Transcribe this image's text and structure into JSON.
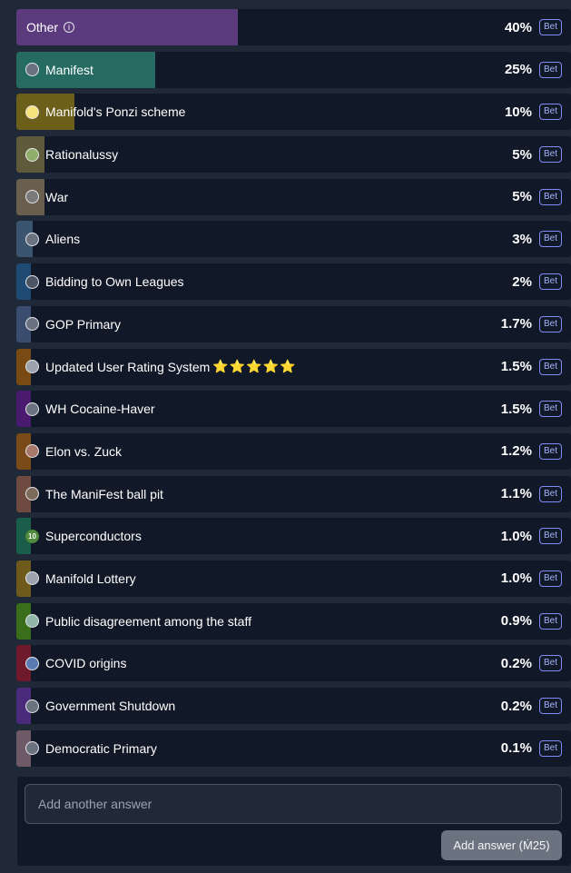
{
  "answers": [
    {
      "label": "Other",
      "percent": "40%",
      "bet": "Bet",
      "fill_ratio": 0.4,
      "color": "#5b3a7e",
      "avatar": "info",
      "avatar_color": ""
    },
    {
      "label": "Manifest",
      "percent": "25%",
      "bet": "Bet",
      "fill_ratio": 0.25,
      "color": "#266b62",
      "avatar": "user-avatar",
      "avatar_color": "#6b7280"
    },
    {
      "label": "Manifold's Ponzi scheme",
      "percent": "10%",
      "bet": "Bet",
      "fill_ratio": 0.105,
      "color": "#6b5f1a",
      "avatar": "user-avatar",
      "avatar_color": "#f6e27a"
    },
    {
      "label": "Rationalussy",
      "percent": "5%",
      "bet": "Bet",
      "fill_ratio": 0.05,
      "color": "#5f5a3c",
      "avatar": "user-avatar",
      "avatar_color": "#8fae6a"
    },
    {
      "label": "War",
      "percent": "5%",
      "bet": "Bet",
      "fill_ratio": 0.05,
      "color": "#6a5f4e",
      "avatar": "user-avatar",
      "avatar_color": "#7a7a7a"
    },
    {
      "label": "Aliens",
      "percent": "3%",
      "bet": "Bet",
      "fill_ratio": 0.03,
      "color": "#3b5570",
      "avatar": "user-avatar",
      "avatar_color": "#6b7280"
    },
    {
      "label": "Bidding to Own Leagues",
      "percent": "2%",
      "bet": "Bet",
      "fill_ratio": 0.025,
      "color": "#1f4a73",
      "avatar": "user-avatar",
      "avatar_color": "#4b5563"
    },
    {
      "label": "GOP Primary",
      "percent": "1.7%",
      "bet": "Bet",
      "fill_ratio": 0.017,
      "color": "#3a4d6e",
      "avatar": "user-avatar",
      "avatar_color": "#6b7280"
    },
    {
      "label": "Updated User Rating System",
      "percent": "1.5%",
      "bet": "Bet",
      "fill_ratio": 0.015,
      "color": "#7a4a14",
      "avatar": "user-avatar",
      "avatar_color": "#9ca3af",
      "stars": "⭐⭐⭐⭐⭐"
    },
    {
      "label": "WH Cocaine-Haver",
      "percent": "1.5%",
      "bet": "Bet",
      "fill_ratio": 0.015,
      "color": "#4a1a6e",
      "avatar": "user-avatar",
      "avatar_color": "#6b7280"
    },
    {
      "label": "Elon vs. Zuck",
      "percent": "1.2%",
      "bet": "Bet",
      "fill_ratio": 0.012,
      "color": "#7a4a18",
      "avatar": "user-avatar",
      "avatar_color": "#a8786a"
    },
    {
      "label": "The ManiFest ball pit",
      "percent": "1.1%",
      "bet": "Bet",
      "fill_ratio": 0.011,
      "color": "#6e4a40",
      "avatar": "user-avatar",
      "avatar_color": "#7d6b5a"
    },
    {
      "label": "Superconductors",
      "percent": "1.0%",
      "bet": "Bet",
      "fill_ratio": 0.01,
      "color": "#1a5e4a",
      "avatar": "badge-10",
      "avatar_color": "#4d8a3a",
      "avatar_text": "10"
    },
    {
      "label": "Manifold Lottery",
      "percent": "1.0%",
      "bet": "Bet",
      "fill_ratio": 0.01,
      "color": "#6e5a1a",
      "avatar": "user-avatar",
      "avatar_color": "#9ca3af"
    },
    {
      "label": "Public disagreement among the staff",
      "percent": "0.9%",
      "bet": "Bet",
      "fill_ratio": 0.009,
      "color": "#3a6e1a",
      "avatar": "user-avatar",
      "avatar_color": "#8fb4a8"
    },
    {
      "label": "COVID origins",
      "percent": "0.2%",
      "bet": "Bet",
      "fill_ratio": 0.002,
      "color": "#6e1a2a",
      "avatar": "user-avatar",
      "avatar_color": "#5a7ab4"
    },
    {
      "label": "Government Shutdown",
      "percent": "0.2%",
      "bet": "Bet",
      "fill_ratio": 0.002,
      "color": "#4a2a7a",
      "avatar": "user-avatar",
      "avatar_color": "#6b7280"
    },
    {
      "label": "Democratic Primary",
      "percent": "0.1%",
      "bet": "Bet",
      "fill_ratio": 0.001,
      "color": "#6e5a66",
      "avatar": "user-avatar",
      "avatar_color": "#6b7280"
    }
  ],
  "add_answer": {
    "placeholder": "Add another answer",
    "button_label": "Add answer (Ṁ25)"
  }
}
